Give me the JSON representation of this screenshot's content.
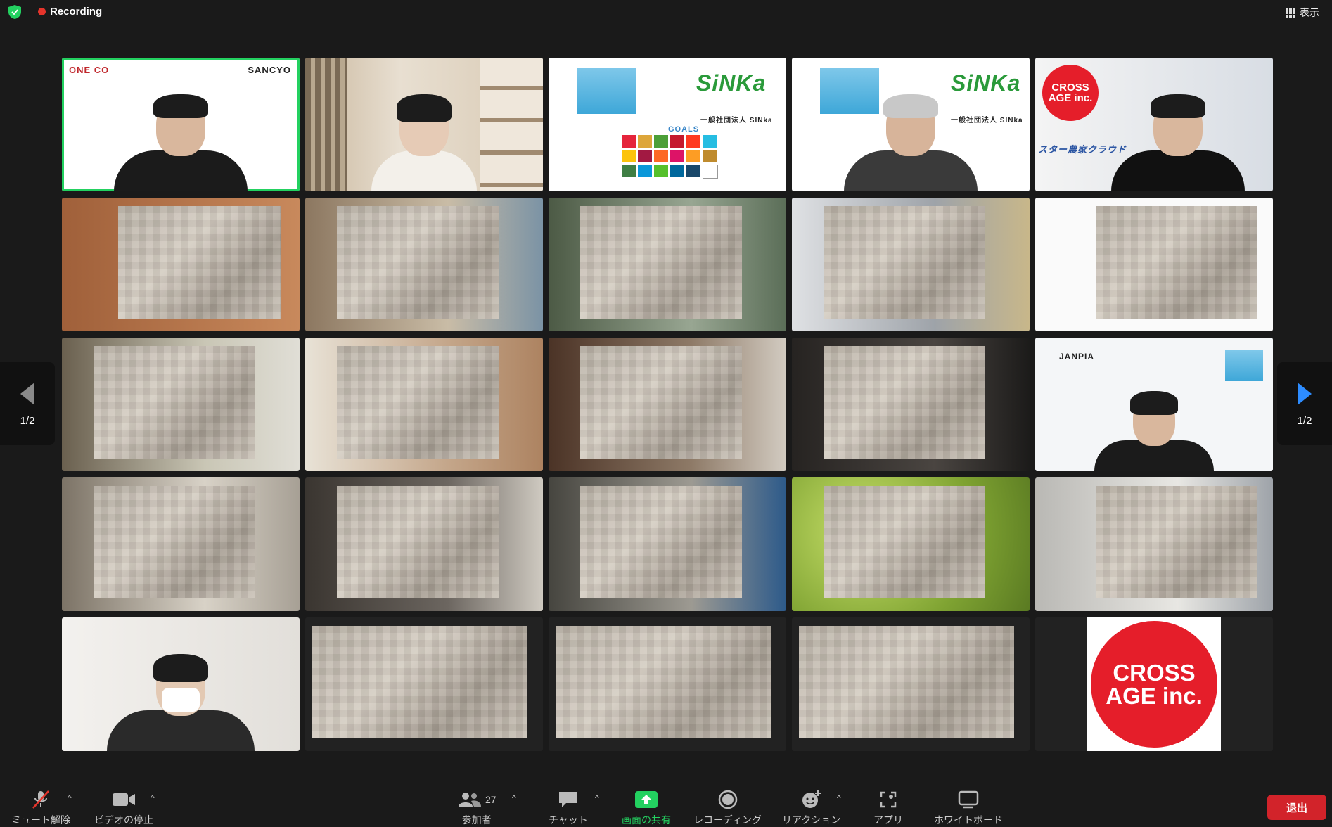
{
  "topbar": {
    "recording_label": "Recording",
    "view_label": "表示"
  },
  "tiles": [
    {
      "logo_left": "ONE CO",
      "logo_right": "SANCYO"
    },
    {},
    {
      "org_label": "一般社団法人 SINka",
      "brand": "SiNKa",
      "goals_label": "GOALS"
    },
    {
      "org_label": "一般社団法人 SINka",
      "brand": "SiNKa"
    },
    {
      "logo_line1": "CROSS",
      "logo_line2": "AGE inc.",
      "banner": "スター農家クラウド"
    },
    {},
    {},
    {},
    {},
    {},
    {},
    {},
    {},
    {},
    {
      "logo": "JANPIA"
    },
    {},
    {},
    {},
    {},
    {},
    {},
    {},
    {},
    {},
    {
      "logo_line1": "CROSS",
      "logo_line2": "AGE inc."
    }
  ],
  "pager": {
    "left_page": "1/2",
    "right_page": "1/2"
  },
  "toolbar": {
    "mute": "ミュート解除",
    "video": "ビデオの停止",
    "participants": "参加者",
    "participants_count": "27",
    "chat": "チャット",
    "share": "画面の共有",
    "record": "レコーディング",
    "reactions": "リアクション",
    "apps": "アプリ",
    "whiteboard": "ホワイトボード",
    "leave": "退出"
  },
  "colors": {
    "active_border": "#23d160",
    "leave": "#d2232a",
    "crossage_red": "#e51e2a"
  }
}
